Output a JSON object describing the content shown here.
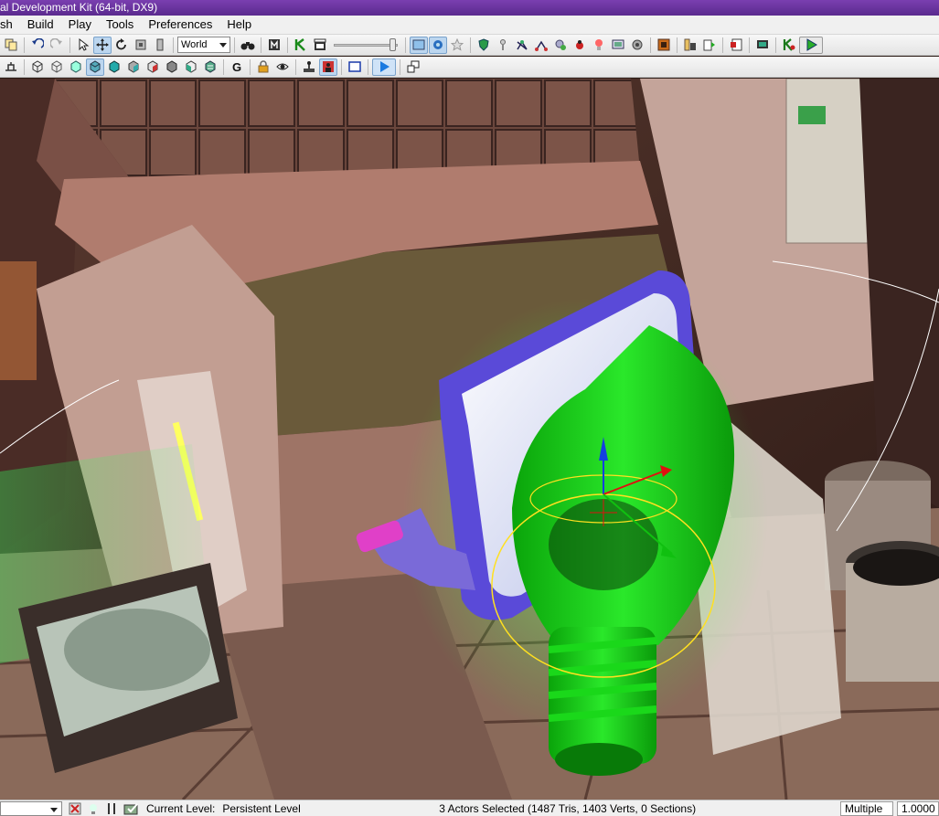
{
  "window": {
    "title": "al Development Kit (64-bit, DX9)"
  },
  "menu": {
    "items": [
      "sh",
      "Build",
      "Play",
      "Tools",
      "Preferences",
      "Help"
    ]
  },
  "toolbar1": {
    "coordinate_space": "World"
  },
  "status": {
    "current_level_label": "Current Level:",
    "current_level_value": "Persistent Level",
    "selection": "3 Actors Selected (1487 Tris, 1403 Verts, 0 Sections)",
    "drag_grid_mode": "Multiple",
    "drag_grid_value": "1.0000"
  },
  "colors": {
    "title_bar": "#6a34a0",
    "gizmo_x": "#e01010",
    "gizmo_y": "#10c010",
    "gizmo_z": "#1040e0",
    "selection_highlight": "#22e022"
  },
  "icons": [
    "copy-icon",
    "undo-icon",
    "redo-icon",
    "select-icon",
    "translate-icon",
    "rotate-icon",
    "scale-icon",
    "nonuniform-scale-icon",
    "binoculars-icon",
    "mode-icon",
    "kismet-icon",
    "clapper-icon",
    "realtime-icon",
    "camera-icon",
    "star-icon",
    "shield-icon",
    "marker-icon",
    "path-icon",
    "path-build-icon",
    "decal-icon",
    "bug-icon",
    "light-icon",
    "screen-icon",
    "sound-icon",
    "content-browser-icon",
    "actor-classes-icon",
    "level-browser-icon",
    "group-icon",
    "monitor-icon",
    "kismet-play-icon",
    "play-icon"
  ]
}
